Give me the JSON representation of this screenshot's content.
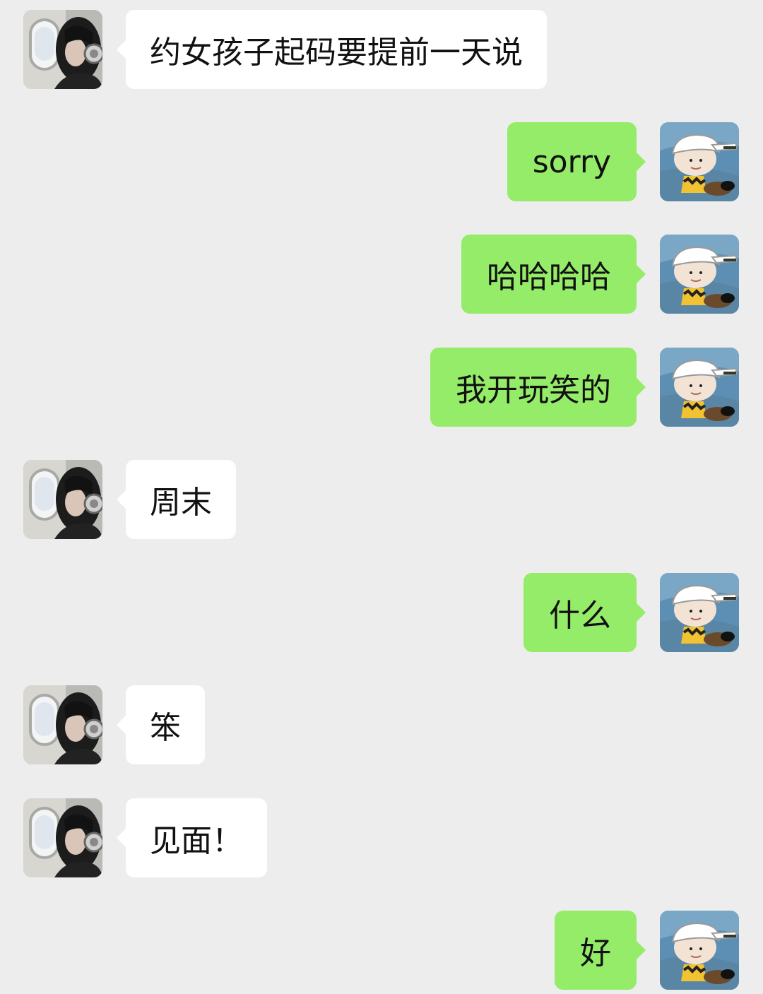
{
  "conversation": {
    "messages": [
      {
        "side": "left",
        "sender": "contact",
        "text": "约女孩子起码要提前一天说"
      },
      {
        "side": "right",
        "sender": "me",
        "text": "sorry"
      },
      {
        "side": "right",
        "sender": "me",
        "text": "哈哈哈哈"
      },
      {
        "side": "right",
        "sender": "me",
        "text": "我开玩笑的"
      },
      {
        "side": "left",
        "sender": "contact",
        "text": "周末"
      },
      {
        "side": "right",
        "sender": "me",
        "text": "什么"
      },
      {
        "side": "left",
        "sender": "contact",
        "text": "笨"
      },
      {
        "side": "left",
        "sender": "contact",
        "text": "见面！"
      },
      {
        "side": "right",
        "sender": "me",
        "text": "好"
      }
    ]
  },
  "avatars": {
    "contact": "girl-with-headphones-photo",
    "me": "cartoon-boy-in-cap"
  },
  "colors": {
    "background": "#ededed",
    "incoming_bubble": "#ffffff",
    "outgoing_bubble": "#95ec69",
    "text": "#111111"
  }
}
